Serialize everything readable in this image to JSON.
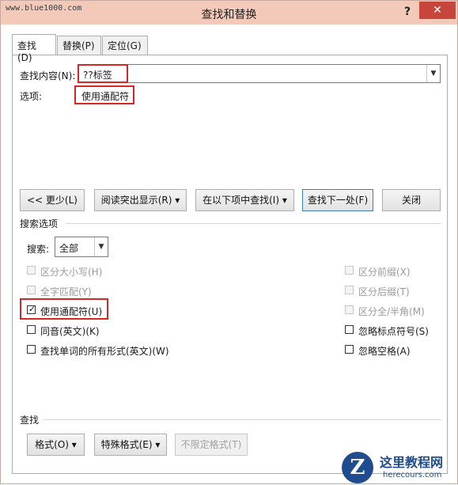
{
  "watermark_top": "www.blue1000.com",
  "window": {
    "title": "查找和替换",
    "help": "?",
    "close": "✕"
  },
  "tabs": [
    "查找(D)",
    "替换(P)",
    "定位(G)"
  ],
  "find": {
    "label": "查找内容(N):",
    "value": "??标签",
    "options_label": "选项:",
    "options_value": "使用通配符"
  },
  "buttons": {
    "less": "<< 更少(L)",
    "reading_highlight": "阅读突出显示(R) ▾",
    "find_in": "在以下项中查找(I) ▾",
    "find_next": "查找下一处(F)",
    "close": "关闭"
  },
  "search_options": {
    "heading": "搜索选项",
    "search_label": "搜索:",
    "search_value": "全部"
  },
  "checkboxes_left": [
    {
      "label": "区分大小写(H)",
      "checked": false,
      "disabled": true
    },
    {
      "label": "全字匹配(Y)",
      "checked": false,
      "disabled": true
    },
    {
      "label": "使用通配符(U)",
      "checked": true,
      "disabled": false
    },
    {
      "label": "同音(英文)(K)",
      "checked": false,
      "disabled": false
    },
    {
      "label": "查找单词的所有形式(英文)(W)",
      "checked": false,
      "disabled": false
    }
  ],
  "checkboxes_right": [
    {
      "label": "区分前缀(X)",
      "checked": false,
      "disabled": true
    },
    {
      "label": "区分后缀(T)",
      "checked": false,
      "disabled": true
    },
    {
      "label": "区分全/半角(M)",
      "checked": false,
      "disabled": true
    },
    {
      "label": "忽略标点符号(S)",
      "checked": false,
      "disabled": false
    },
    {
      "label": "忽略空格(A)",
      "checked": false,
      "disabled": false
    }
  ],
  "find_section": {
    "heading": "查找",
    "format": "格式(O) ▾",
    "special": "特殊格式(E) ▾",
    "no_format": "不限定格式(T)"
  },
  "logo": {
    "letter": "Z",
    "name": "这里教程网",
    "url": "herecours.com"
  }
}
